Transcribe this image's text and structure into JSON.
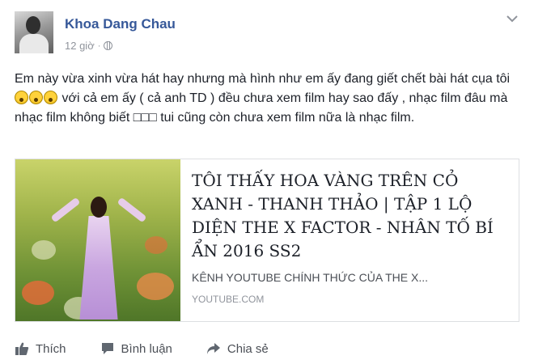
{
  "post": {
    "author": "Khoa Dang Chau",
    "time": "12 giờ",
    "separator": "·",
    "text_before_emoji": "Em này vừa xinh vừa hát hay nhưng mà hình như em ấy đang giết chết bài hát cụa tôi ",
    "emoji_count": 3,
    "emoji_icon": "scream-emoji-icon",
    "text_after_emoji": " với cả em ấy ( cả anh TD ) đều chưa xem film hay sao đấy , nhạc film đâu mà nhạc film không biết □□□ tui cũng còn chưa xem film nữa là nhạc film."
  },
  "link_card": {
    "title": "TÔI THẤY HOA VÀNG TRÊN CỎ XANH - THANH THẢO | TẬP 1 LỘ DIỆN THE X FACTOR - NHÂN TỐ BÍ ẨN 2016 SS2",
    "description": "KÊNH YOUTUBE CHÍNH THỨC CỦA THE X...",
    "domain": "YOUTUBE.COM"
  },
  "actions": {
    "like": "Thích",
    "comment": "Bình luận",
    "share": "Chia sẻ"
  },
  "colors": {
    "author_link": "#365899",
    "meta_gray": "#90949c",
    "text": "#1d2129",
    "action_text": "#4b4f56"
  }
}
